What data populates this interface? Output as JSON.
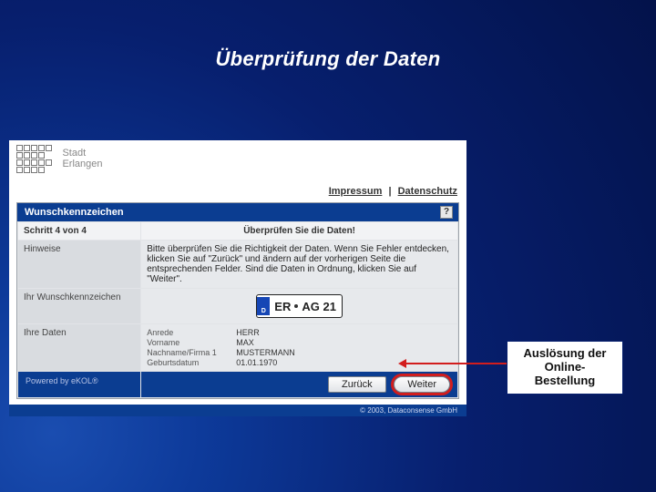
{
  "slide": {
    "title": "Überprüfung der Daten"
  },
  "logo": {
    "line1": "Stadt",
    "line2": "Erlangen"
  },
  "toplinks": {
    "impressum": "Impressum",
    "datenschutz": "Datenschutz"
  },
  "panel": {
    "title": "Wunschkennzeichen",
    "help": "?",
    "step": "Schritt 4 von 4",
    "step_header": "Überprüfen Sie die Daten!",
    "rows": {
      "hinweise_label": "Hinweise",
      "hinweise_text": "Bitte überprüfen Sie die Richtigkeit der Daten. Wenn Sie Fehler entdecken, klicken Sie auf \"Zurück\" und ändern auf der vorherigen Seite die entsprechenden Felder. Sind die Daten in Ordnung, klicken Sie auf \"Weiter\".",
      "plate_label": "Ihr Wunschkennzeichen",
      "plate_region": "ER",
      "plate_letters": "AG",
      "plate_digits": "21",
      "data_label": "Ihre Daten",
      "fields": {
        "anrede_k": "Anrede",
        "anrede_v": "HERR",
        "vorname_k": "Vorname",
        "vorname_v": "MAX",
        "nachname_k": "Nachname/Firma 1",
        "nachname_v": "MUSTERMANN",
        "geb_k": "Geburtsdatum",
        "geb_v": "01.01.1970"
      }
    },
    "powered": "Powered by eKOL®",
    "buttons": {
      "back": "Zurück",
      "next": "Weiter"
    },
    "copyright": "© 2003, Dataconsense GmbH"
  },
  "callout": {
    "line1": "Auslösung der",
    "line2": "Online-",
    "line3": "Bestellung"
  }
}
